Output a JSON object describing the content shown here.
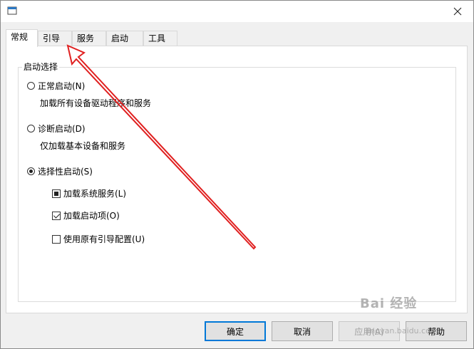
{
  "tabs": [
    "常规",
    "引导",
    "服务",
    "启动",
    "工具"
  ],
  "group": {
    "title": "启动选择",
    "normal": {
      "label": "正常启动(N)",
      "desc": "加载所有设备驱动程序和服务",
      "checked": false
    },
    "diagnostic": {
      "label": "诊断启动(D)",
      "desc": "仅加载基本设备和服务",
      "checked": false
    },
    "selective": {
      "label": "选择性启动(S)",
      "checked": true
    },
    "load_services": {
      "label": "加载系统服务(L)",
      "state": "indeterminate"
    },
    "load_startup": {
      "label": "加载启动项(O)",
      "state": "checked"
    },
    "use_boot": {
      "label": "使用原有引导配置(U)",
      "state": "unchecked"
    }
  },
  "buttons": {
    "ok": "确定",
    "cancel": "取消",
    "apply": "应用(A)",
    "help": "帮助"
  },
  "watermark": {
    "text": "Bai 经验",
    "sub": "jingyan.baidu.com"
  },
  "colors": {
    "annotation_arrow": "#e02020",
    "focus_border": "#0078d7"
  }
}
